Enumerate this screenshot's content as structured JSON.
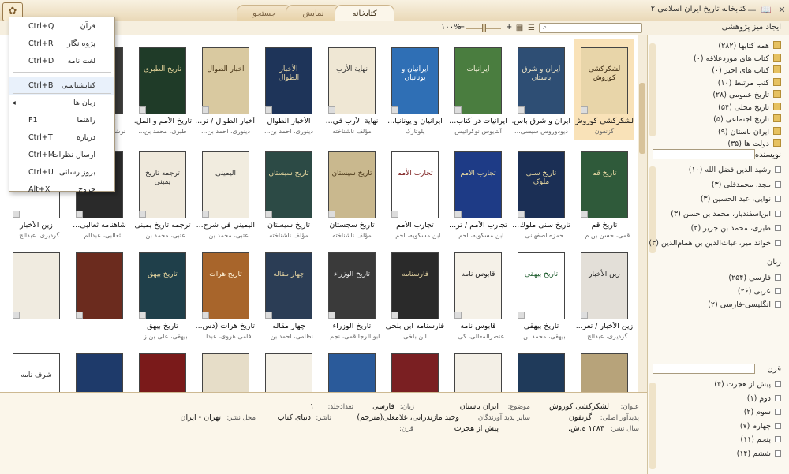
{
  "window": {
    "title": "کتابخانه تاریخ ایران اسلامی ۲",
    "tabs": [
      "کتابخانه",
      "نمایش",
      "جستجو"
    ],
    "logo_icon": "library-logo-icon"
  },
  "toolbar": {
    "research_desk": "ایجاد میز پژوهشی",
    "zoom": "۱۰۰%",
    "zoom_minus": "−",
    "zoom_plus": "+"
  },
  "books": [
    {
      "title": "لشکرکشی کوروش",
      "author": "گزنفون",
      "cover": "#e8d5a9",
      "text": "لشکرکشی کوروش",
      "tc": "#3b2a12",
      "selected": true
    },
    {
      "title": "ایران و شرق باس...",
      "author": "دیودوروس سیسی...",
      "cover": "#2e4e74",
      "text": "ایران و شرق باستان",
      "tc": "#f0e6c8"
    },
    {
      "title": "ایرانیات در کتاب...",
      "author": "آنتایوس نوکراتیس",
      "cover": "#4a7d3f",
      "text": "ایرانیات",
      "tc": "#f4eed8"
    },
    {
      "title": "ایرانیان و یونانیا...",
      "author": "پلوتارک",
      "cover": "#2f6fb5",
      "text": "ایرانیان و یونانیان",
      "tc": "#ffffff"
    },
    {
      "title": "نهایة الأرب في...",
      "author": "مؤلف ناشناخته",
      "cover": "#efe7d4",
      "text": "نهایة الأرب",
      "tc": "#333"
    },
    {
      "title": "الأخبار الطوال",
      "author": "دینوری، احمد بن...",
      "cover": "#1e3459",
      "text": "الأخبار الطوال",
      "tc": "#e9d9a8"
    },
    {
      "title": "أخبار الطوال / تر...",
      "author": "دینوری، احمد بن...",
      "cover": "#d9c9a0",
      "text": "اخبار الطوال",
      "tc": "#4a3718"
    },
    {
      "title": "تاریخ الأمم و المل...",
      "author": "طبری، محمد بن...",
      "cover": "#1f3b28",
      "text": "تاریخ الطبری",
      "tc": "#e5d49a"
    },
    {
      "title": "تاریخ بخارا",
      "author": "نرشخی، محمد ب...",
      "cover": "#3a3a38",
      "text": "تاریخ بخارا",
      "tc": "#e0d0a0"
    },
    {
      "title": "تاریخ بخاری",
      "author": "نرشخی، محمد ب...",
      "cover": "#c4342e",
      "text": "تاریخ بخارا",
      "tc": "#fff"
    },
    {
      "title": "تاریخ قم",
      "author": "قمی، حسن بن م...",
      "cover": "#2f5a3a",
      "text": "تاریخ قم",
      "tc": "#e8d9a4"
    },
    {
      "title": "تاریخ سنی ملوك...",
      "author": "حمزه اصفهانی...",
      "cover": "#1b2f55",
      "text": "تاریخ سنی ملوک",
      "tc": "#e8d8a0"
    },
    {
      "title": "تجارب الأمم / تر...",
      "author": "ابن مسکویه، احم...",
      "cover": "#1e3b86",
      "text": "تجارب الامم",
      "tc": "#e8d8a0"
    },
    {
      "title": "تجارب الأمم",
      "author": "ابن مسکویه، احم...",
      "cover": "#ffffff",
      "text": "تجارب الأمم",
      "tc": "#7a1a1a"
    },
    {
      "title": "تاریخ سجستان",
      "author": "مؤلف ناشناخته",
      "cover": "#c9b88e",
      "text": "تاریخ سیستان",
      "tc": "#4a3718"
    },
    {
      "title": "تاریخ سیستان",
      "author": "مؤلف ناشناخته",
      "cover": "#2c4a45",
      "text": "تاریخ سیستان",
      "tc": "#e8d8a0"
    },
    {
      "title": "الیمیني في شرح...",
      "author": "عتبی، محمد بن...",
      "cover": "#f1ecdf",
      "text": "الیمینی",
      "tc": "#333"
    },
    {
      "title": "ترجمه تاریخ یمینی",
      "author": "عتبی، محمد بن...",
      "cover": "#efe9dc",
      "text": "ترجمه تاریخ یمینی",
      "tc": "#333"
    },
    {
      "title": "شاهنامه ثعالبی...",
      "author": "ثعالبی، عبدالم...",
      "cover": "#2a2a2a",
      "text": "شاهنامه ثعالبی",
      "tc": "#e0d0a0"
    },
    {
      "title": "زین الأخبار",
      "author": "گردیزی، عبدالح...",
      "cover": "#ffffff",
      "text": "زین الأخبار",
      "tc": "#111"
    },
    {
      "title": "زین الأخبار / تعر...",
      "author": "گردیزی، عبدالح...",
      "cover": "#e3dfd8",
      "text": "زين الأخبار",
      "tc": "#222"
    },
    {
      "title": "تاریخ بیهقی",
      "author": "بیهقی، محمد بن...",
      "cover": "#ffffff",
      "text": "تاریخ بیهقی",
      "tc": "#1a5a2a"
    },
    {
      "title": "قابوس نامه",
      "author": "عنصرالمعالی، کی...",
      "cover": "#f5f1e8",
      "text": "قابوس نامه",
      "tc": "#222"
    },
    {
      "title": "فارسنامه ابن بلخی",
      "author": "ابن بلخی",
      "cover": "#2a2a2a",
      "text": "فارسنامه",
      "tc": "#e0d0a0"
    },
    {
      "title": "تاریخ الوزراء",
      "author": "ابو الرجا قمی، نجم...",
      "cover": "#3a3a3a",
      "text": "تاریخ الوزراء",
      "tc": "#e6e6e6"
    },
    {
      "title": "چهار مقاله",
      "author": "نظامی، احمد بن...",
      "cover": "#2b3d55",
      "text": "چهار مقاله",
      "tc": "#e0d0a0"
    },
    {
      "title": "تاریخ هرات (دس...",
      "author": "فامی هروی، عبدا...",
      "cover": "#a8652b",
      "text": "تاریخ هرات",
      "tc": "#fff3d8"
    },
    {
      "title": "تاریخ بیهق",
      "author": "بیهقی، علی بن ز...",
      "cover": "#1f3f4a",
      "text": "تاریخ بیهق",
      "tc": "#e8d8a0"
    },
    {
      "title": "",
      "author": "",
      "cover": "#6b2b1e",
      "text": "",
      "tc": "#e8d8a0"
    },
    {
      "title": "",
      "author": "",
      "cover": "#f0ebe0",
      "text": "",
      "tc": "#333"
    },
    {
      "title": "",
      "author": "",
      "cover": "#b7a37a",
      "text": "",
      "tc": "#333"
    },
    {
      "title": "",
      "author": "",
      "cover": "#1f3a5a",
      "text": "",
      "tc": "#e0d0a0"
    },
    {
      "title": "",
      "author": "",
      "cover": "#f3efe6",
      "text": "",
      "tc": "#333"
    },
    {
      "title": "",
      "author": "",
      "cover": "#7a1f22",
      "text": "",
      "tc": "#e8d8a0"
    },
    {
      "title": "",
      "author": "",
      "cover": "#2a5a9a",
      "text": "",
      "tc": "#fff"
    },
    {
      "title": "",
      "author": "",
      "cover": "#f4f0e6",
      "text": "",
      "tc": "#333"
    },
    {
      "title": "",
      "author": "",
      "cover": "#e6ddc8",
      "text": "",
      "tc": "#333"
    },
    {
      "title": "",
      "author": "",
      "cover": "#7a1a1a",
      "text": "",
      "tc": "#eee"
    },
    {
      "title": "",
      "author": "",
      "cover": "#1e3a6a",
      "text": "",
      "tc": "#fff"
    },
    {
      "title": "",
      "author": "",
      "cover": "#ffffff",
      "text": "شرف نامه",
      "tc": "#333"
    }
  ],
  "sidebar": {
    "collections": [
      {
        "label": "همه کتابها (۲۸۲)",
        "icon": "folder-icon"
      },
      {
        "label": "کتاب های موردعلاقه (۰)",
        "icon": "star-icon"
      },
      {
        "label": "کتاب های اخیر (۰)",
        "icon": "folder-icon"
      },
      {
        "label": "کتب مرتبط (۱۰)",
        "icon": "folder-icon"
      },
      {
        "label": "تاریخ عمومی (۲۸)",
        "icon": "folder-icon"
      },
      {
        "label": "تاریخ محلی (۵۴)",
        "icon": "folder-icon"
      },
      {
        "label": "تاریخ اجتماعی (۵)",
        "icon": "folder-icon"
      },
      {
        "label": "ایران باستان (۹)",
        "icon": "folder-icon"
      },
      {
        "label": "دولت ها (۳۵)",
        "icon": "folder-icon"
      }
    ],
    "author_header": "نویسنده",
    "authors": [
      "رشید الدین فضل الله (۱۰)",
      "مجد، محمدقلی (۳)",
      "نوایی، عبد الحسین (۳)",
      "ابن‌اسفندیار، محمد بن حسن (۳)",
      "طبری، محمد بن جریر (۳)",
      "خواند میر، غیاث‌الدین بن همام‌الدین (۳)"
    ],
    "language_header": "زبان",
    "languages": [
      "فارسی (۲۵۴)",
      "عربی (۲۶)",
      "انگلیسی-فارسی (۲)"
    ],
    "century_header": "قرن",
    "centuries": [
      "پیش از هجرت (۴)",
      "دوم (۱)",
      "سوم (۲)",
      "چهارم (۷)",
      "پنجم (۱۱)",
      "ششم (۱۴)"
    ]
  },
  "details": {
    "title_label": "عنوان:",
    "title": "لشکرکشی کوروش",
    "subject_label": "موضوع:",
    "subject": "ایران باستان",
    "language_label": "زبان:",
    "language": "فارسی",
    "volumes_label": "تعدادجلد:",
    "volumes": "۱",
    "author_label": "پدیدآور اصلی:",
    "author": "گزنفون",
    "others_label": "سایر پدید آورندگان:",
    "others": "وحید مازندرانی، غلامعلی(مترجم)",
    "publisher_label": "ناشر:",
    "publisher": "دنیای کتاب",
    "place_label": "محل نشر:",
    "place": "تهران - ایران",
    "year_label": "سال نشر:",
    "year": "۱۳۸۴ ه.ش.",
    "century_label": "قرن:",
    "century": "پیش از هجرت"
  },
  "menu": [
    {
      "label": "قرآن",
      "shortcut": "Ctrl+Q"
    },
    {
      "label": "پژوه نگار",
      "shortcut": "Ctrl+R"
    },
    {
      "label": "لغت نامه",
      "shortcut": "Ctrl+D"
    },
    {
      "label": "کتابشناسی",
      "shortcut": "Ctrl+B"
    },
    {
      "label": "زبان ها",
      "shortcut": "◂"
    },
    {
      "label": "راهنما",
      "shortcut": "F1"
    },
    {
      "label": "درباره",
      "shortcut": "Ctrl+T"
    },
    {
      "label": "ارسال نظرات",
      "shortcut": "Ctrl+M"
    },
    {
      "label": "بروز رسانی",
      "shortcut": "Ctrl+U"
    },
    {
      "label": "خروج",
      "shortcut": "Alt+X"
    }
  ]
}
